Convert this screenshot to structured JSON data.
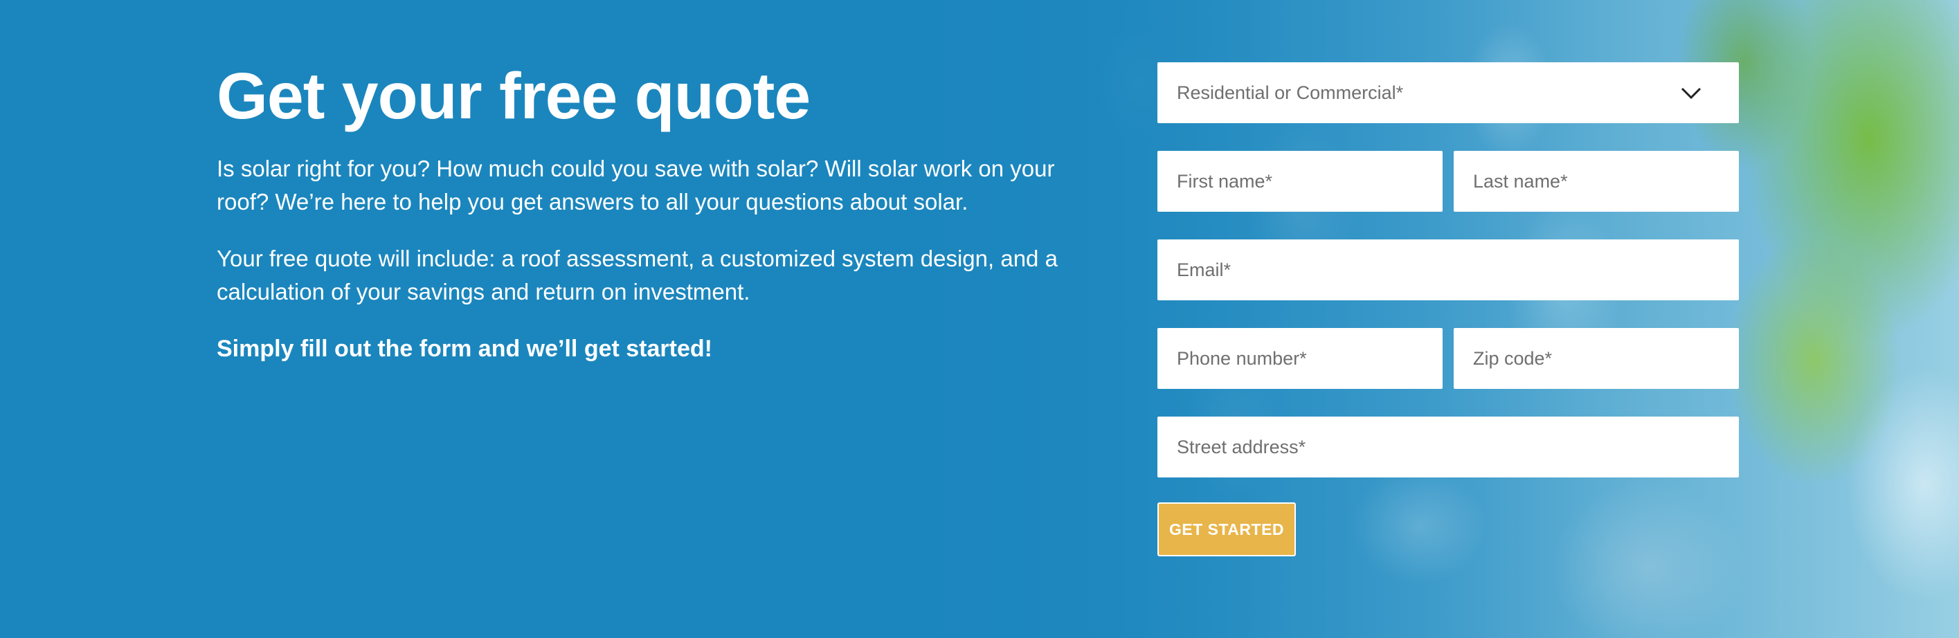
{
  "hero": {
    "headline": "Get your free quote",
    "paragraph_1": "Is solar right for you? How much could you save with solar? Will solar work on your roof? We’re here to help you get answers to all your questions about solar.",
    "paragraph_2": "Your free quote will include: a roof assessment, a customized system design, and a calculation of your savings and return on investment.",
    "cta_note": "Simply fill out the form and we’ll get started!"
  },
  "form": {
    "property_type": {
      "placeholder": "Residential or Commercial*",
      "icon": "chevron-down-icon"
    },
    "first_name": {
      "placeholder": "First name*"
    },
    "last_name": {
      "placeholder": "Last name*"
    },
    "email": {
      "placeholder": "Email*"
    },
    "phone": {
      "placeholder": "Phone number*"
    },
    "zip": {
      "placeholder": "Zip code*"
    },
    "street": {
      "placeholder": "Street address*"
    },
    "submit_label": "GET STARTED"
  },
  "colors": {
    "primary_blue": "#1c87be",
    "button_gold": "#e8b54a",
    "field_bg": "#ffffff",
    "text_white": "#ffffff"
  }
}
